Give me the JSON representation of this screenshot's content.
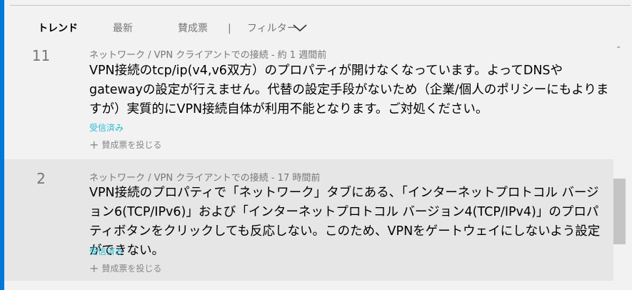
{
  "tabs": [
    {
      "label": "トレンド",
      "active": true
    },
    {
      "label": "最新",
      "active": false
    },
    {
      "label": "賛成票",
      "active": false
    }
  ],
  "separator": "|",
  "filter": {
    "label": "フィルター",
    "icon": "chevron-down-icon"
  },
  "items": [
    {
      "votes": "11",
      "meta": "ネットワーク / VPN クライアントでの接続 - 約 1 週間前",
      "body": "VPN接続のtcp/ip(v4,v6双方）のプロパティが開けなくなっています。よってDNSやgatewayの設定が行えません。代替の設定手段がないため（企業/個人のポリシーにもよりますが）実質的にVPN接続自体が利用不能となります。ご対処ください。",
      "status": "受信済み",
      "vote_label": "賛成票を投じる"
    },
    {
      "votes": "2",
      "meta": "ネットワーク / VPN クライアントでの接続 - 17 時間前",
      "body": "VPN接続のプロパティで「ネットワーク」タブにある、「インターネットプロトコル バージョン6(TCP/IPv6)」および「インターネットプロトコル バージョン4(TCP/IPv4)」のプロパティボタンをクリックしても反応しない。このため、VPNをゲートウェイにしないよう設定ができない。",
      "status": "受信済み",
      "vote_label": "賛成票を投じる"
    }
  ],
  "colors": {
    "accent": "#0078d7",
    "status": "#2bbbd5",
    "selected_bg": "#e6e6e6"
  }
}
